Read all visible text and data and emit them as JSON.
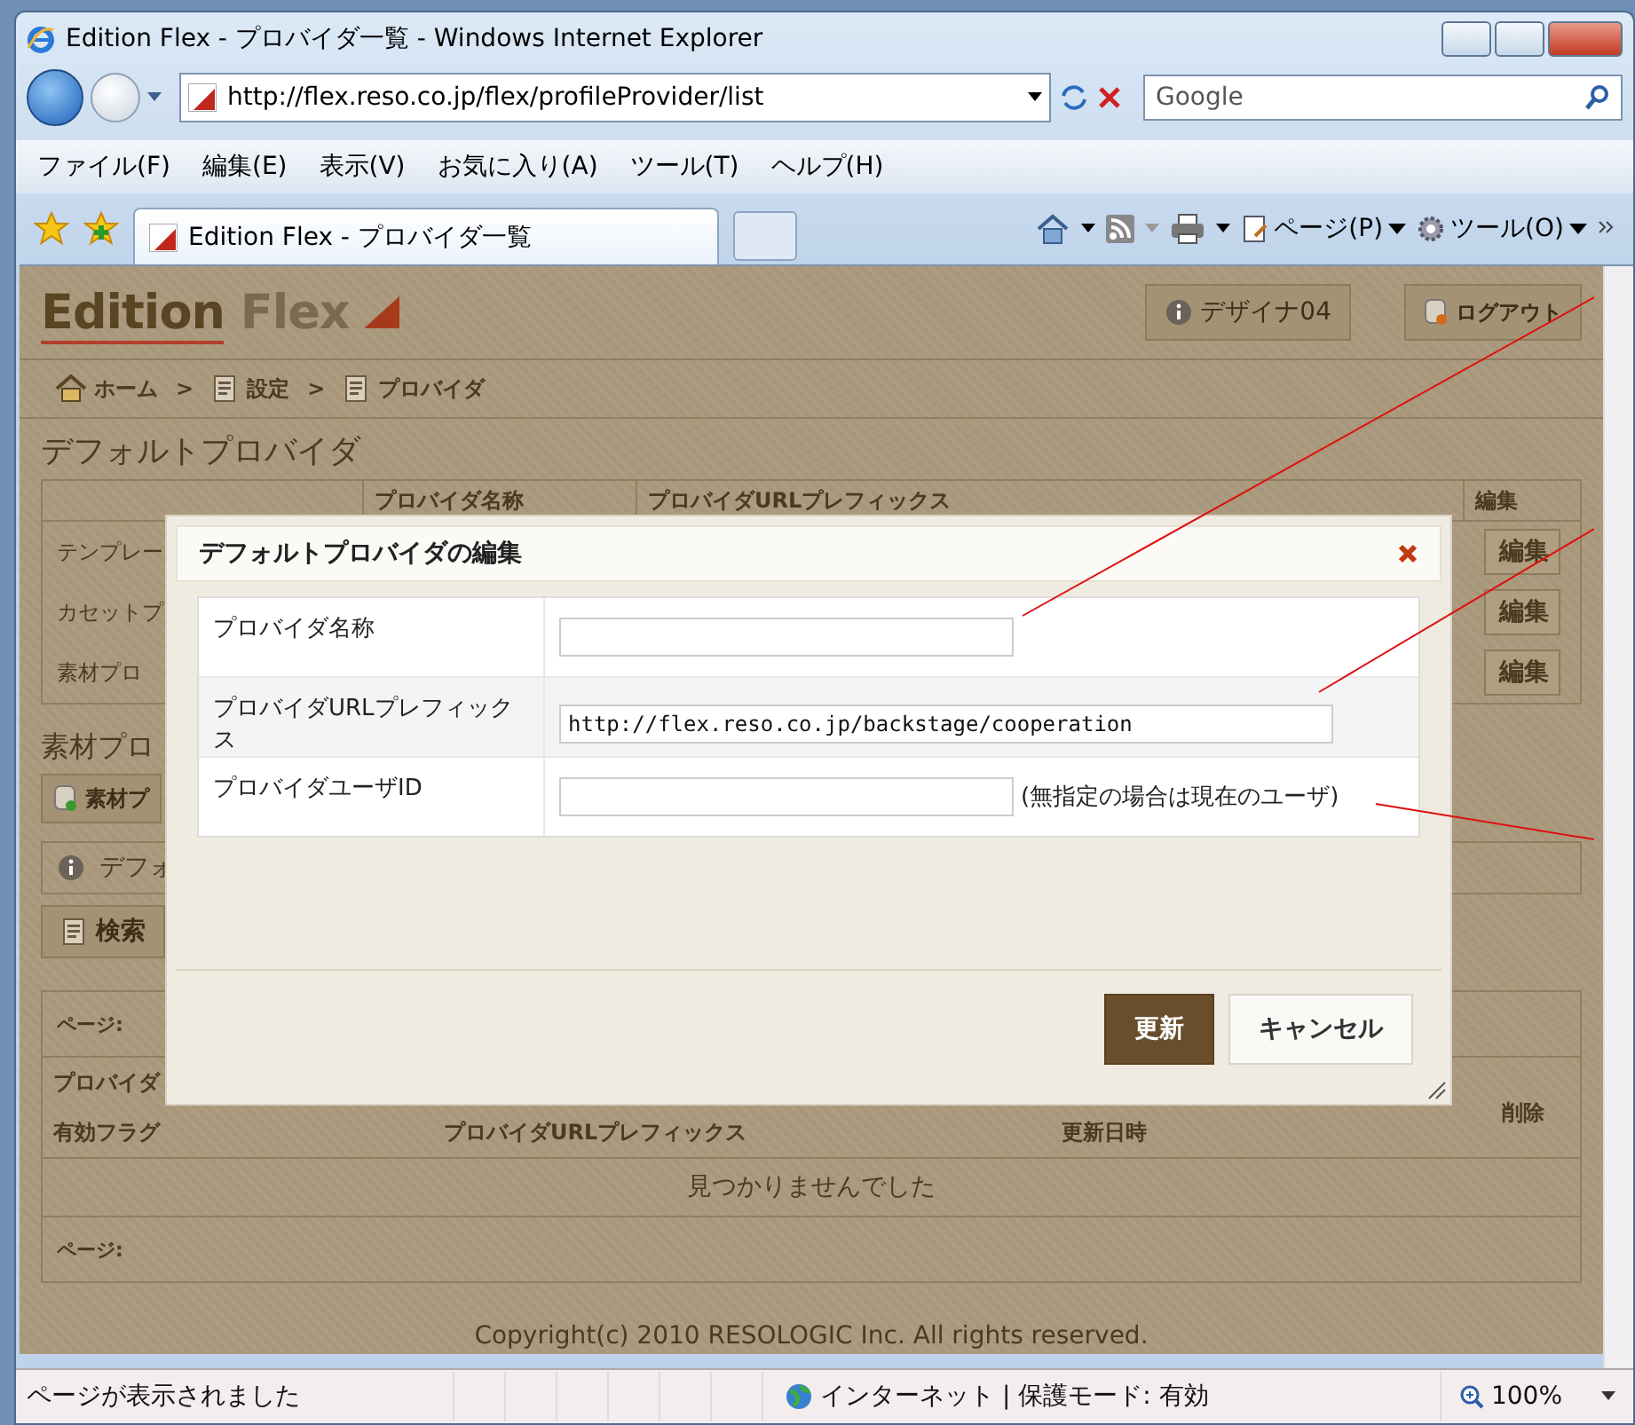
{
  "window": {
    "title": "Edition Flex - プロバイダ一覧 - Windows Internet Explorer"
  },
  "address_bar": {
    "url": "http://flex.reso.co.jp/flex/profileProvider/list"
  },
  "search": {
    "placeholder": "Google"
  },
  "menu": [
    "ファイル(F)",
    "編集(E)",
    "表示(V)",
    "お気に入り(A)",
    "ツール(T)",
    "ヘルプ(H)"
  ],
  "tabs": [
    {
      "label": "Edition Flex - プロバイダ一覧",
      "selected": true
    }
  ],
  "command_bar": [
    {
      "label": "ページ(P)",
      "kind": "page"
    },
    {
      "label": "ツール(O)",
      "kind": "tools"
    }
  ],
  "page": {
    "logo": [
      "Edition",
      "Flex"
    ],
    "user": "デザイナ04",
    "logout": "ログアウト",
    "breadcrumb": [
      {
        "label": "ホーム",
        "kind": "home"
      },
      {
        "separator": ">",
        "label": "設定",
        "kind": "page"
      },
      {
        "separator": ">",
        "label": "プロバイダ",
        "kind": "page"
      }
    ],
    "default_section": {
      "heading": "デフォルトプロバイダ",
      "columns": [
        "プロバイダ名称",
        "プロバイダURLプレフィックス",
        "編集"
      ],
      "rows": [
        {
          "name": "テンプレー",
          "action": "編集"
        },
        {
          "name": "カセットプ",
          "action": "編集"
        },
        {
          "name": "素材プロ",
          "action": "編集"
        }
      ]
    },
    "material_section": {
      "heading": "素材プロ",
      "add_button": "素材プ"
    },
    "info_bar": "デフォ",
    "search_panel": "検索",
    "list": {
      "pager_top": "ページ:",
      "header_row_1": [
        "プロバイダ"
      ],
      "header_row_2": [
        "有効フラグ",
        "プロバイダURLプレフィックス",
        "更新日時"
      ],
      "delete_column": "削除",
      "empty_message": "見つかりませんでした",
      "pager_bottom": "ページ:"
    },
    "copyright": "Copyright(c) 2010 RESOLOGIC Inc. All rights reserved."
  },
  "dialog": {
    "title": "デフォルトプロバイダの編集",
    "fields": [
      {
        "label": "プロバイダ名称"
      },
      {
        "label": "プロバイダURLプレフィックス",
        "value": "http://flex.reso.co.jp/backstage/cooperation"
      },
      {
        "label": "プロバイダユーザID",
        "note": "(無指定の場合は現在のユーザ)"
      }
    ],
    "buttons": [
      {
        "label": "更新",
        "kind": "primary"
      },
      {
        "label": "キャンセル",
        "kind": "secondary"
      }
    ]
  },
  "status_bar": {
    "text": "ページが表示されました",
    "zone": "インターネット | 保護モード: 有効",
    "zoom": "100%"
  }
}
